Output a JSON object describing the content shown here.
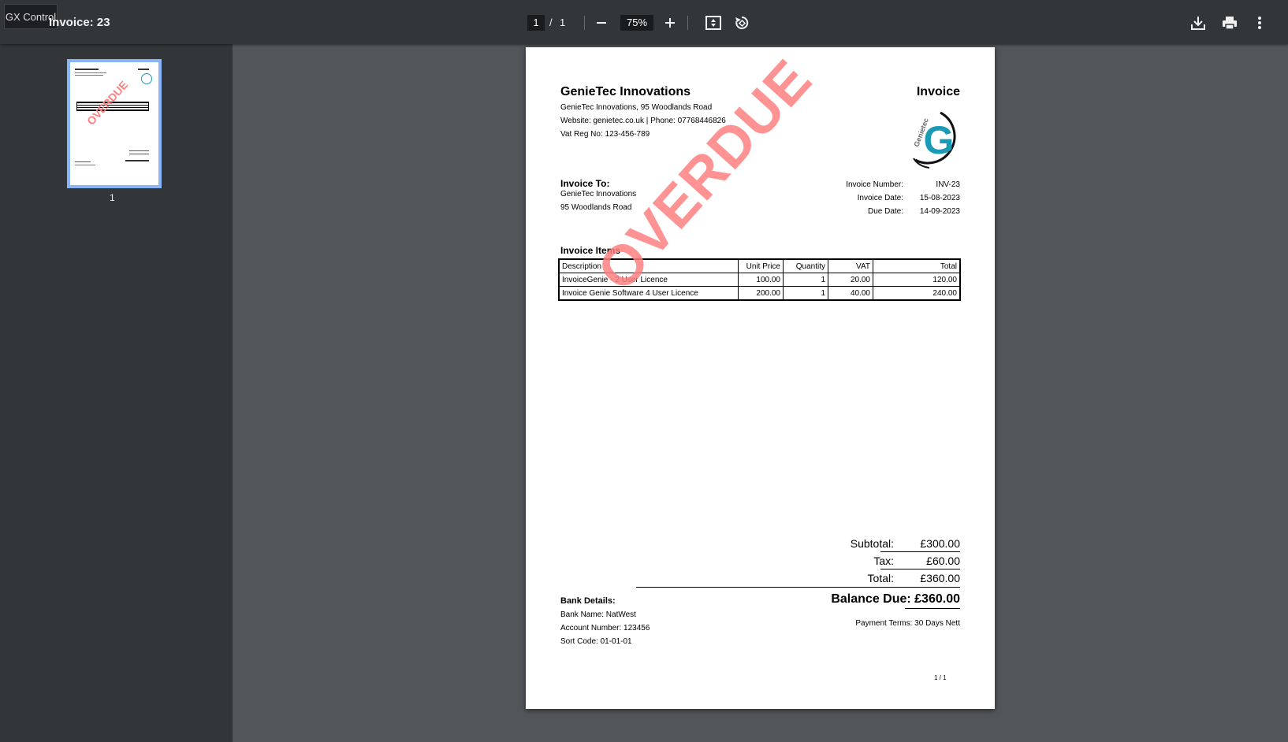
{
  "toolbar": {
    "badge": "GX Control",
    "title": "Invoice: 23",
    "page_current": "1",
    "page_sep": "/",
    "page_total": "1",
    "zoom": "75%"
  },
  "sidebar": {
    "thumb_number": "1"
  },
  "document": {
    "company_name": "GenieTec Innovations",
    "company_address": "GenieTec Innovations, 95 Woodlands Road",
    "company_contact": "Website: genietec.co.uk | Phone: 07768446826",
    "vat_reg": "Vat Reg No: 123-456-789",
    "doc_title": "Invoice",
    "logo_text": "Genietec",
    "logo_letter": "G",
    "invoice_to_label": "Invoice To:",
    "invoice_to_name": "GenieTec Innovations",
    "invoice_to_address": "95 Woodlands Road",
    "meta": [
      {
        "label": "Invoice Number:",
        "value": "INV-23"
      },
      {
        "label": "Invoice Date:",
        "value": "15-08-2023"
      },
      {
        "label": "Due Date:",
        "value": "14-09-2023"
      }
    ],
    "items_heading": "Invoice Items",
    "items_headers": [
      "Description",
      "Unit Price",
      "Quantity",
      "VAT",
      "Total"
    ],
    "items": [
      [
        "InvoiceGenie - 2 User Licence",
        "100.00",
        "1",
        "20.00",
        "120.00"
      ],
      [
        "Invoice Genie Software 4 User Licence",
        "200.00",
        "1",
        "40.00",
        "240.00"
      ]
    ],
    "watermark": "OVERDUE",
    "subtotal_label": "Subtotal:",
    "subtotal_value": "£300.00",
    "tax_label": "Tax:",
    "tax_value": "£60.00",
    "total_label": "Total:",
    "total_value": "£360.00",
    "balance_due": "Balance Due: £360.00",
    "bank_heading": "Bank Details:",
    "bank_name": "Bank Name: NatWest",
    "account_number": "Account Number: 123456",
    "sort_code": "Sort Code: 01-01-01",
    "payment_terms": "Payment Terms: 30 Days Nett",
    "page_footer": "1 / 1"
  },
  "colors": {
    "toolbar_bg": "#323639",
    "viewer_bg": "#525659",
    "watermark": "#ff7f7f",
    "logo_teal": "#1a9bb5",
    "thumb_border": "#8ab4f8"
  },
  "icons": [
    "menu-icon",
    "minus-icon",
    "plus-icon",
    "fit-page-icon",
    "rotate-icon",
    "download-icon",
    "print-icon",
    "more-vert-icon"
  ]
}
